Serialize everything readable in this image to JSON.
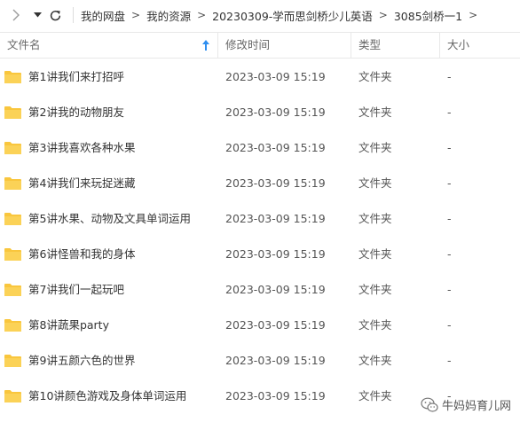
{
  "nav": {
    "back_icon": "chevron-right-icon",
    "dropdown_icon": "caret-down-icon",
    "refresh_icon": "refresh-icon",
    "breadcrumb": [
      "我的网盘",
      "我的资源",
      "20230309-学而思剑桥少儿英语",
      "3085剑桥一1"
    ],
    "separator": ">"
  },
  "columns": {
    "name": "文件名",
    "modified": "修改时间",
    "type": "类型",
    "size": "大小"
  },
  "rows": [
    {
      "name": "第1讲我们来打招呼",
      "modified": "2023-03-09 15:19",
      "type": "文件夹",
      "size": "-"
    },
    {
      "name": "第2讲我的动物朋友",
      "modified": "2023-03-09 15:19",
      "type": "文件夹",
      "size": "-"
    },
    {
      "name": "第3讲我喜欢各种水果",
      "modified": "2023-03-09 15:19",
      "type": "文件夹",
      "size": "-"
    },
    {
      "name": "第4讲我们来玩捉迷藏",
      "modified": "2023-03-09 15:19",
      "type": "文件夹",
      "size": "-"
    },
    {
      "name": "第5讲水果、动物及文具单词运用",
      "modified": "2023-03-09 15:19",
      "type": "文件夹",
      "size": "-"
    },
    {
      "name": "第6讲怪兽和我的身体",
      "modified": "2023-03-09 15:19",
      "type": "文件夹",
      "size": "-"
    },
    {
      "name": "第7讲我们一起玩吧",
      "modified": "2023-03-09 15:19",
      "type": "文件夹",
      "size": "-"
    },
    {
      "name": "第8讲蔬果party",
      "modified": "2023-03-09 15:19",
      "type": "文件夹",
      "size": "-"
    },
    {
      "name": "第9讲五颜六色的世界",
      "modified": "2023-03-09 15:19",
      "type": "文件夹",
      "size": "-"
    },
    {
      "name": "第10讲颜色游戏及身体单词运用",
      "modified": "2023-03-09 15:19",
      "type": "文件夹",
      "size": "-"
    }
  ],
  "watermark": {
    "text": "牛妈妈育儿网"
  },
  "colors": {
    "folder": "#f9c63d",
    "sort_arrow": "#2f8ff0",
    "border": "#e8e8e8"
  }
}
